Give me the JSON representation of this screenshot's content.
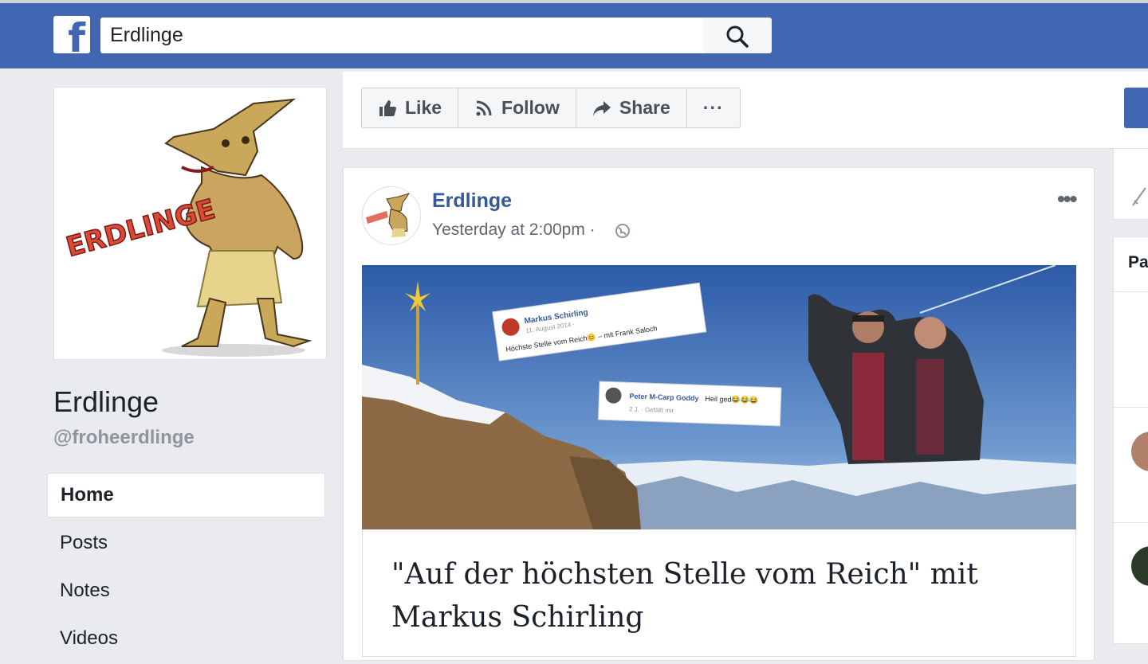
{
  "search": {
    "value": "Erdlinge"
  },
  "page": {
    "name": "Erdlinge",
    "handle": "@froheerdlinge"
  },
  "nav": {
    "items": [
      "Home",
      "Posts",
      "Notes",
      "Videos"
    ]
  },
  "actions": {
    "like": "Like",
    "follow": "Follow",
    "share": "Share",
    "more": "···"
  },
  "post": {
    "author": "Erdlinge",
    "timestamp": "Yesterday at 2:00pm ·",
    "link_title": "\"Auf der höchsten Stelle vom Reich\" mit Markus Schirling",
    "image_overlay_1": {
      "name": "Markus Schirling",
      "date": "11. August 2014 ·",
      "text": "Höchste Stelle vom Reich😊 – mit Frank Saloch"
    },
    "image_overlay_2": {
      "name": "Peter M-Carp Goddy",
      "text": "Heil ged😂😂😂",
      "meta": "2 J. · Gefällt mir"
    }
  },
  "right": {
    "card_label": "Pa"
  },
  "logo_text": "ERDLINGE",
  "colors": {
    "brand": "#4267b2",
    "link": "#365899"
  }
}
